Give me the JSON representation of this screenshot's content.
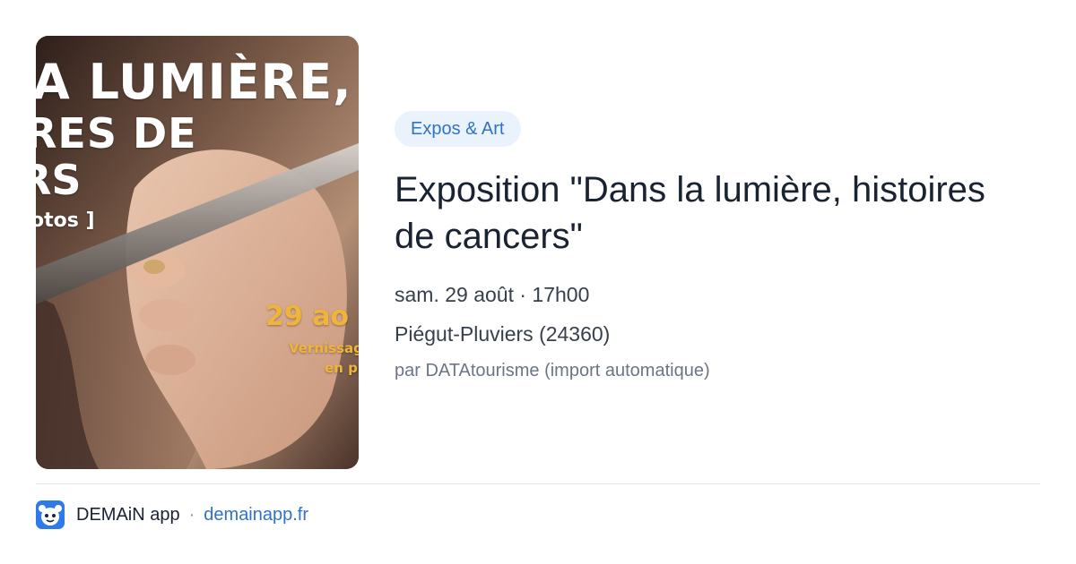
{
  "poster": {
    "line1": "A LUMIÈRE,",
    "line2": "RES DE",
    "line3": "RS",
    "line4": "otos ]",
    "date_fragment": "29 ao",
    "vernissage_fragment": "Vernissag",
    "presence_fragment": "en prése"
  },
  "event": {
    "category": "Expos & Art",
    "title": "Exposition \"Dans la lumière, histoires de cancers\"",
    "datetime": "sam. 29 août · 17h00",
    "location": "Piégut-Pluviers (24360)",
    "source": "par DATAtourisme (import automatique)"
  },
  "footer": {
    "app_name": "DEMAiN app",
    "separator": "·",
    "url": "demainapp.fr"
  },
  "colors": {
    "accent": "#2f73c4",
    "chip_bg": "#eaf2fb",
    "title": "#1a2332",
    "meta": "#37404d",
    "muted": "#6b7585"
  }
}
